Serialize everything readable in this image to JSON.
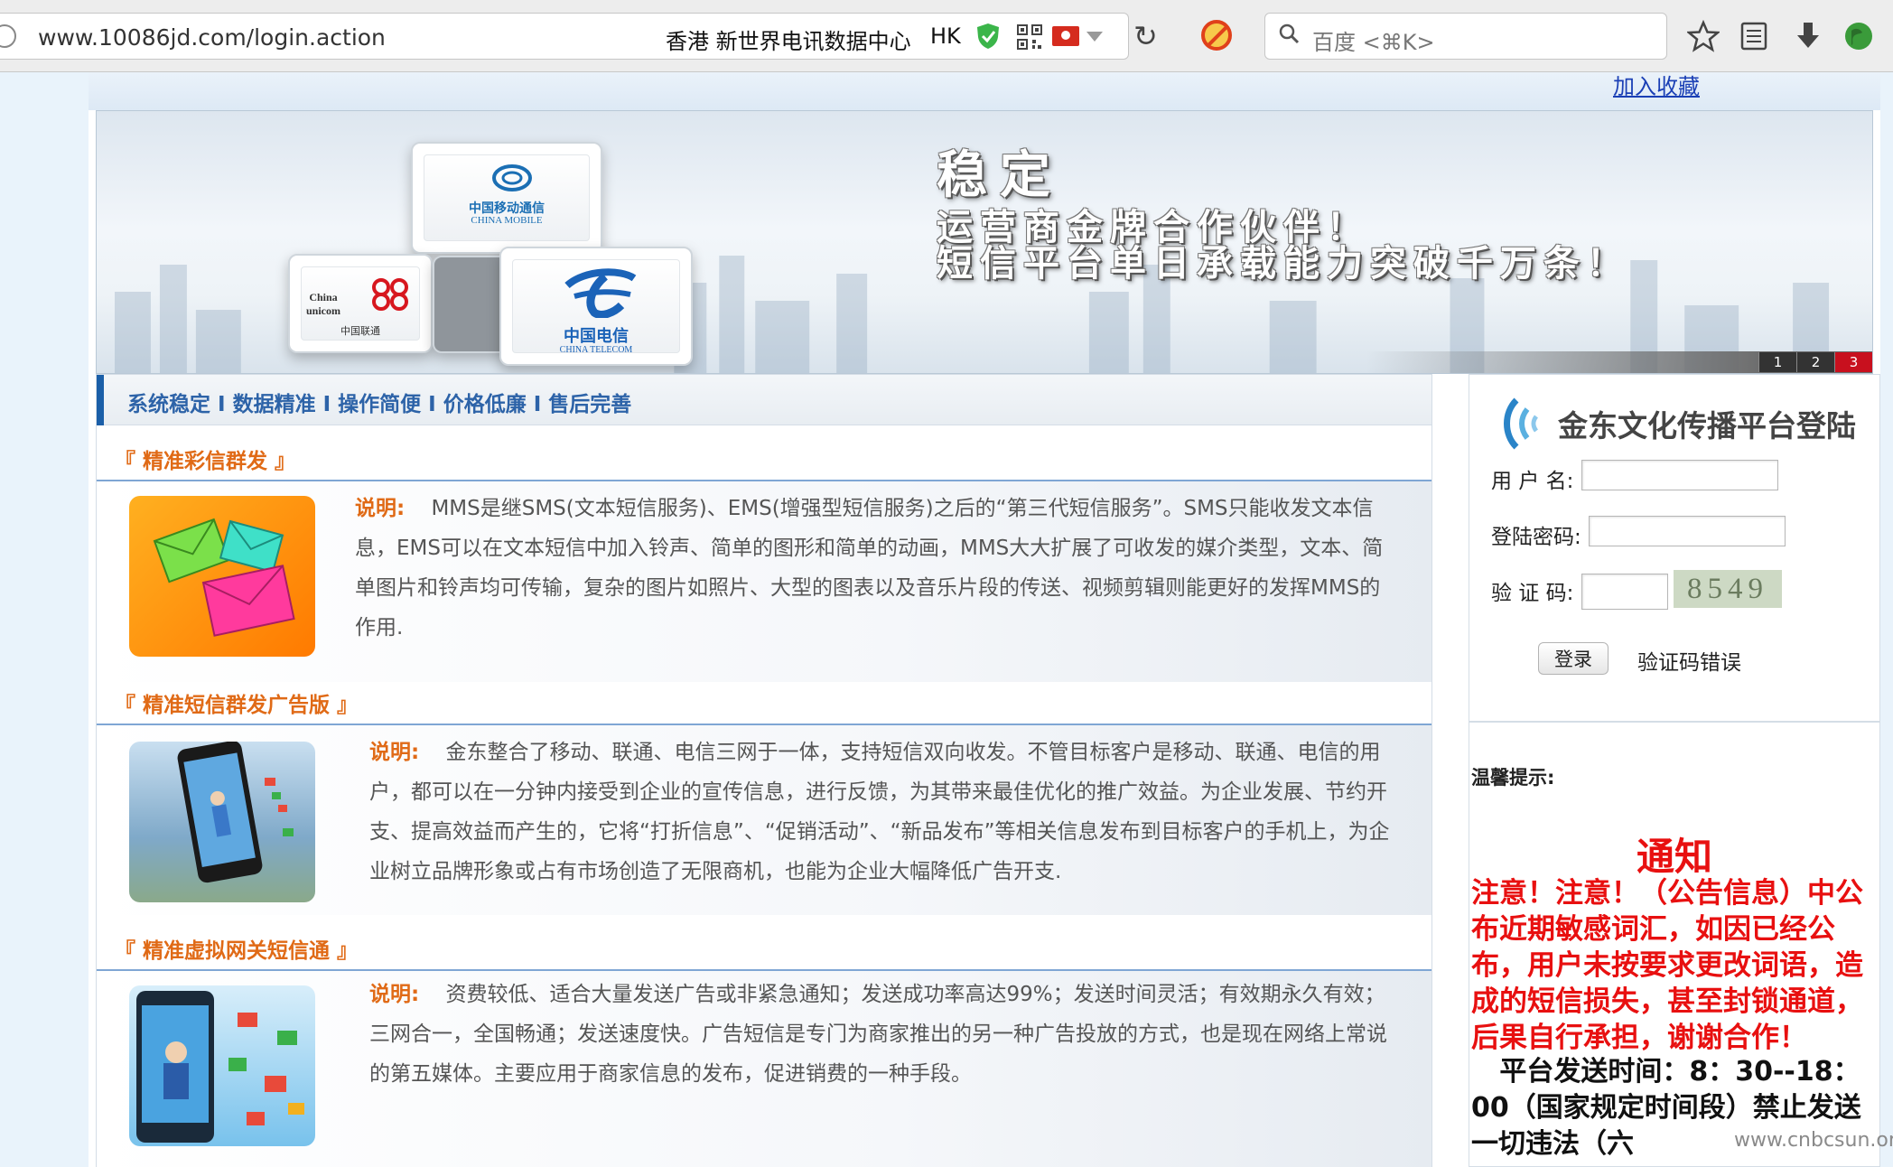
{
  "browser": {
    "url": "www.10086jd.com/login.action",
    "site_info": "香港 新世界电讯数据中心",
    "site_region": "HK",
    "search_placeholder": "百度 <⌘K>"
  },
  "page": {
    "favorite_link": "加入收藏",
    "banner": {
      "headline": "稳定",
      "line1": "运营商金牌合作伙伴！",
      "line2": "短信平台单日承载能力突破千万条！",
      "carrier_mobile_cn": "中国移动通信",
      "carrier_mobile_en": "CHINA MOBILE",
      "carrier_unicom_en": "China unicom",
      "carrier_unicom_cn": "中国联通",
      "carrier_telecom_cn": "中国电信",
      "carrier_telecom_en": "CHINA TELECOM",
      "pager": [
        "1",
        "2",
        "3"
      ],
      "active_page": "3"
    },
    "slogan": "系统稳定 I 数据精准 I 操作简便 I 价格低廉 I 售后完善",
    "sections": [
      {
        "title": "『 精准彩信群发 』",
        "label": "说明:",
        "text": "MMS是继SMS(文本短信服务)、EMS(增强型短信服务)之后的“第三代短信服务”。SMS只能收发文本信息，EMS可以在文本短信中加入铃声、简单的图形和简单的动画，MMS大大扩展了可收发的媒介类型，文本、简单图片和铃声均可传输，复杂的图片如照片、大型的图表以及音乐片段的传送、视频剪辑则能更好的发挥MMS的作用."
      },
      {
        "title": "『 精准短信群发广告版 』",
        "label": "说明:",
        "text": "金东整合了移动、联通、电信三网于一体，支持短信双向收发。不管目标客户是移动、联通、电信的用户，都可以在一分钟内接受到企业的宣传信息，进行反馈，为其带来最佳优化的推广效益。为企业发展、节约开支、提高效益而产生的，它将“打折信息”、“促销活动”、“新品发布”等相关信息发布到目标客户的手机上，为企业树立品牌形象或占有市场创造了无限商机，也能为企业大幅降低广告开支."
      },
      {
        "title": "『 精准虚拟网关短信通 』",
        "label": "说明:",
        "text": "资费较低、适合大量发送广告或非紧急通知；发送成功率高达99%；发送时间灵活；有效期永久有效；三网合一，全国畅通；发送速度快。广告短信是专门为商家推出的另一种广告投放的方式，也是现在网络上常说的第五媒体。主要应用于商家信息的发布，促进销费的一种手段。"
      }
    ],
    "login": {
      "title": "金东文化传播平台登陆",
      "username_label": "用 户 名:",
      "username_value": "",
      "password_label": "登陆密码:",
      "password_value": "",
      "captcha_label": "验 证 码:",
      "captcha_value": "",
      "captcha_image_text": "8549",
      "submit_label": "登录",
      "error_text": "验证码错误"
    },
    "tips": {
      "label": "温馨提示:",
      "notice_title": "通知",
      "notice_text": "注意！注意！（公告信息）中公布近期敏感词汇，如因已经公布，用户未按要求更改词语，造成的短信损失，甚至封锁通道，后果自行承担，谢谢合作！",
      "schedule_text": "平台发送时间：8：30--18：00（国家规定时间段）禁止发送一切违法（六"
    },
    "watermark": "www.cnbcsun.org"
  },
  "colors": {
    "accent_orange": "#e06a16",
    "slogan_blue": "#2d63a8",
    "notice_red": "#e81010"
  }
}
